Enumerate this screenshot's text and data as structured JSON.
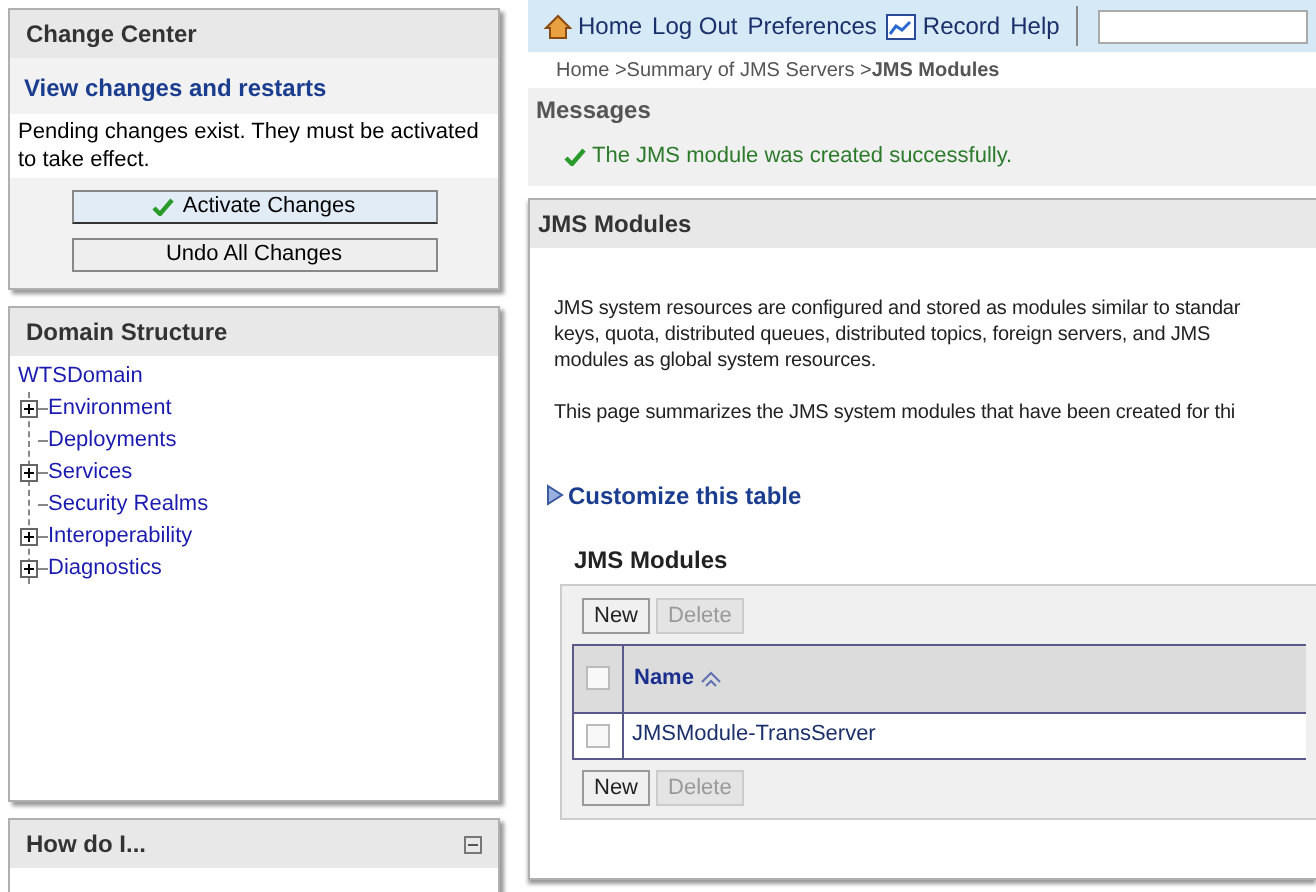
{
  "change_center": {
    "title": "Change Center",
    "link": "View changes and restarts",
    "message": "Pending changes exist. They must be activated to take effect.",
    "buttons": [
      {
        "label": "Activate Changes",
        "kind": "check"
      },
      {
        "label": "Undo All Changes",
        "kind": "plain"
      }
    ]
  },
  "domain_structure": {
    "title": "Domain Structure",
    "root": "WTSDomain",
    "children": [
      {
        "label": "Environment",
        "kind": "branch",
        "expanded": false
      },
      {
        "label": "Deployments",
        "kind": "leaf"
      },
      {
        "label": "Services",
        "kind": "branch",
        "expanded": false
      },
      {
        "label": "Security Realms",
        "kind": "leaf"
      },
      {
        "label": "Interoperability",
        "kind": "branch",
        "expanded": false
      },
      {
        "label": "Diagnostics",
        "kind": "branch",
        "expanded": false
      }
    ]
  },
  "how_do_i": {
    "title": "How do I..."
  },
  "toolbar": {
    "items": [
      {
        "label": "Home",
        "kind": "home"
      },
      {
        "label": "Log Out",
        "kind": "text"
      },
      {
        "label": "Preferences",
        "kind": "text"
      },
      {
        "label": "Record",
        "kind": "record"
      },
      {
        "label": "Help",
        "kind": "text"
      }
    ]
  },
  "breadcrumb": [
    {
      "label": "Home >",
      "current": false
    },
    {
      "label": "Summary of JMS Servers >",
      "current": false
    },
    {
      "label": "JMS Modules",
      "current": true
    }
  ],
  "messages": {
    "title": "Messages",
    "text": "The JMS module was created successfully."
  },
  "content": {
    "title": "JMS Modules",
    "description_lines": [
      "JMS system resources are configured and stored as modules similar to standar",
      "keys, quota, distributed queues, distributed topics, foreign servers, and JMS",
      "modules as global system resources."
    ],
    "summary": "This page summarizes the JMS system modules that have been created for thi",
    "customize": "Customize this table",
    "table": {
      "title": "JMS Modules",
      "top_buttons": [
        {
          "label": "New",
          "disabled": false
        },
        {
          "label": "Delete",
          "disabled": true
        }
      ],
      "header_checked": false,
      "columns": [
        "Name"
      ],
      "rows": [
        {
          "name": "JMSModule-TransServer",
          "checked": false
        }
      ],
      "bottom_buttons": [
        {
          "label": "New",
          "disabled": false
        },
        {
          "label": "Delete",
          "disabled": true
        }
      ]
    }
  }
}
